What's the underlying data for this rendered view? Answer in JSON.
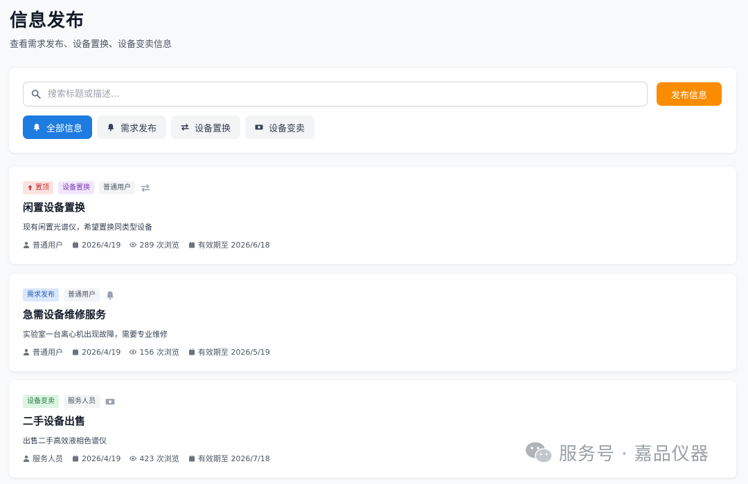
{
  "header": {
    "title": "信息发布",
    "subtitle": "查看需求发布、设备置换、设备变卖信息"
  },
  "search": {
    "placeholder": "搜索标题或描述...",
    "value": ""
  },
  "publish_label": "发布信息",
  "tabs": [
    {
      "label": "全部信息",
      "icon": "bell-icon",
      "active": true
    },
    {
      "label": "需求发布",
      "icon": "bell-icon",
      "active": false
    },
    {
      "label": "设备置换",
      "icon": "exchange-icon",
      "active": false
    },
    {
      "label": "设备变卖",
      "icon": "money-icon",
      "active": false
    }
  ],
  "posts": [
    {
      "pinned_label": "置顶",
      "category": "设备置换",
      "role": "普通用户",
      "type_icon": "exchange-icon",
      "title": "闲置设备置换",
      "description": "现有闲置光谱仪，希望置换同类型设备",
      "author": "普通用户",
      "date": "2026/4/19",
      "views": "289 次浏览",
      "expiry": "有效期至 2026/6/18"
    },
    {
      "category": "需求发布",
      "role": "普通用户",
      "type_icon": "bell-icon",
      "title": "急需设备维修服务",
      "description": "实验室一台离心机出现故障，需要专业维修",
      "author": "普通用户",
      "date": "2026/4/19",
      "views": "156 次浏览",
      "expiry": "有效期至 2026/5/19"
    },
    {
      "category": "设备变卖",
      "role": "服务人员",
      "type_icon": "money-icon",
      "title": "二手设备出售",
      "description": "出售二手高效液相色谱仪",
      "author": "服务人员",
      "date": "2026/4/19",
      "views": "423 次浏览",
      "expiry": "有效期至 2026/7/18"
    }
  ],
  "watermark": "服务号 · 嘉品仪器",
  "colors": {
    "primary": "#1e7be0",
    "accent": "#fb8c00",
    "pin": "#c62828",
    "exchange": "#7e3bbd",
    "demand": "#2b5fb7",
    "sale": "#2e7d46"
  }
}
